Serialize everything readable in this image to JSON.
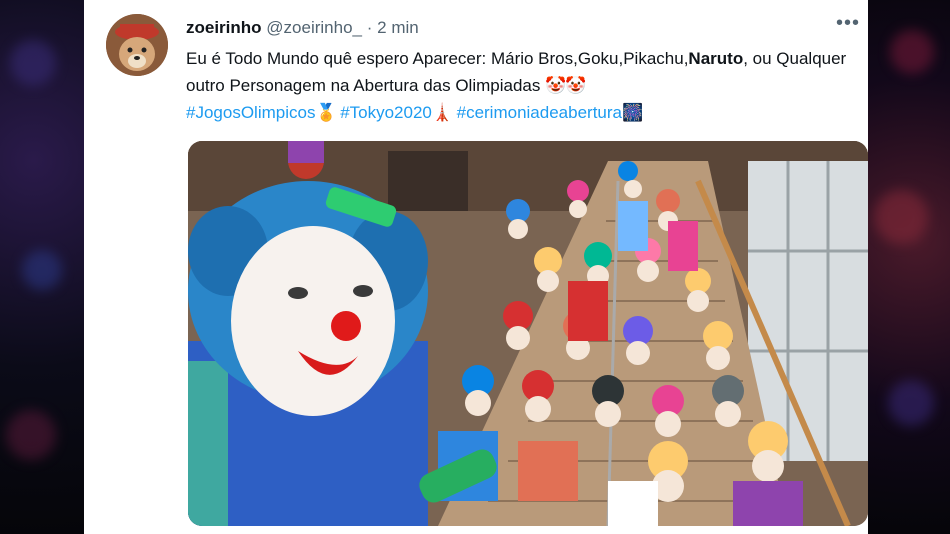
{
  "tweet": {
    "display_name": "zoeirinho",
    "handle": "@zoeirinho_",
    "separator": "·",
    "time": "2 min",
    "more_label": "•••",
    "text_part1": "Eu é Todo Mundo quê espero Aparecer: Mário Bros,Goku,Pikachu,",
    "text_bold": "Naruto",
    "text_part2": ", ou Qualquer outro Personagem na Abertura das Olimpiadas",
    "emoji1": "🤡",
    "emoji2": "🤡",
    "hashtags": [
      {
        "text": "#JogosOlimpicos",
        "emoji": "🏅"
      },
      {
        "text": "#Tokyo2020",
        "emoji": "🗼"
      },
      {
        "text": "#cerimoniadeabertura",
        "emoji": "🎆"
      }
    ]
  },
  "colors": {
    "hashtag": "#1d9bf0",
    "text": "#0f1419",
    "muted": "#536471"
  },
  "media": {
    "icon": "photo-of-clowns-on-staircase"
  }
}
